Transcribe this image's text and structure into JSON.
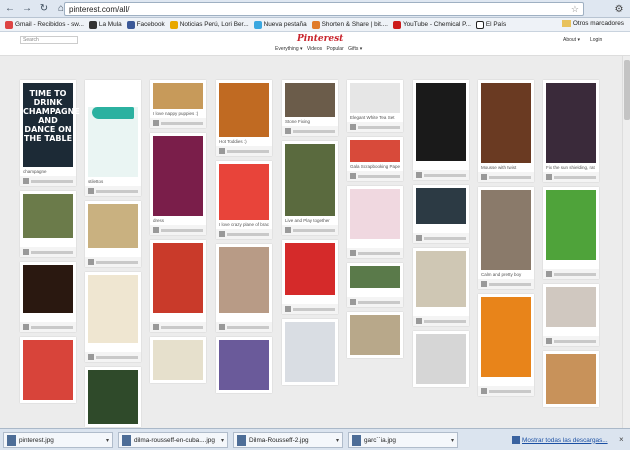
{
  "browser": {
    "url": "pinterest.com/all/",
    "back_icon": "back-arrow-icon",
    "forward_icon": "forward-arrow-icon",
    "reload_icon": "reload-icon",
    "home_icon": "home-icon"
  },
  "bookmarks": {
    "items": [
      {
        "label": "Gmail - Recibidos - sw..."
      },
      {
        "label": "La Mula"
      },
      {
        "label": "Facebook"
      },
      {
        "label": "Noticias Perú, Lori Ber..."
      },
      {
        "label": "Nueva pestaña"
      },
      {
        "label": "Shorten & Share | bit...."
      },
      {
        "label": "YouTube - Chemical P..."
      },
      {
        "label": "El País"
      }
    ],
    "other": "Otros marcadores"
  },
  "pinterest": {
    "search_placeholder": "Search",
    "logo": "Pinterest",
    "nav": [
      "Everything ▾",
      "Videos",
      "Popular",
      "Gifts ▾"
    ],
    "account": "About ▾",
    "login": "Login"
  },
  "pins": {
    "poster_text": "TIME TO DRINK CHAMPAGNE AND DANCE ON THE TABLE",
    "poster_caption": "champagne",
    "dog_caption": "I love nappy puppies :)",
    "tea_caption": "Hot Toddies :)",
    "bracelet_caption": "I love crazy plane of bracelets",
    "shoes_caption": "stilettos",
    "dress_caption": "dress",
    "stone_caption": "Stone Fixing",
    "rooms_caption": "Live and Play together",
    "goodies_caption": "Gala Scrapbooking Paper",
    "teaset_caption": "Elegant White Tea Set",
    "dessert_caption": "Mousse with twist",
    "lady_caption": "Fix the sun shielding, rat chez",
    "plaid_caption": "Calm and pretty boy"
  },
  "downloads": {
    "items": [
      {
        "name": "pinterest.jpg"
      },
      {
        "name": "dilma-rousseff-en-cuba....jpg"
      },
      {
        "name": "Dilma-Rousseff-2.jpg"
      },
      {
        "name": "garc´´ia.jpg"
      }
    ],
    "show_all": "Mostrar todas las descargas...",
    "close": "×"
  },
  "colors": {
    "pinterest_red": "#c8232c",
    "toolbar": "#dfe7f1"
  }
}
